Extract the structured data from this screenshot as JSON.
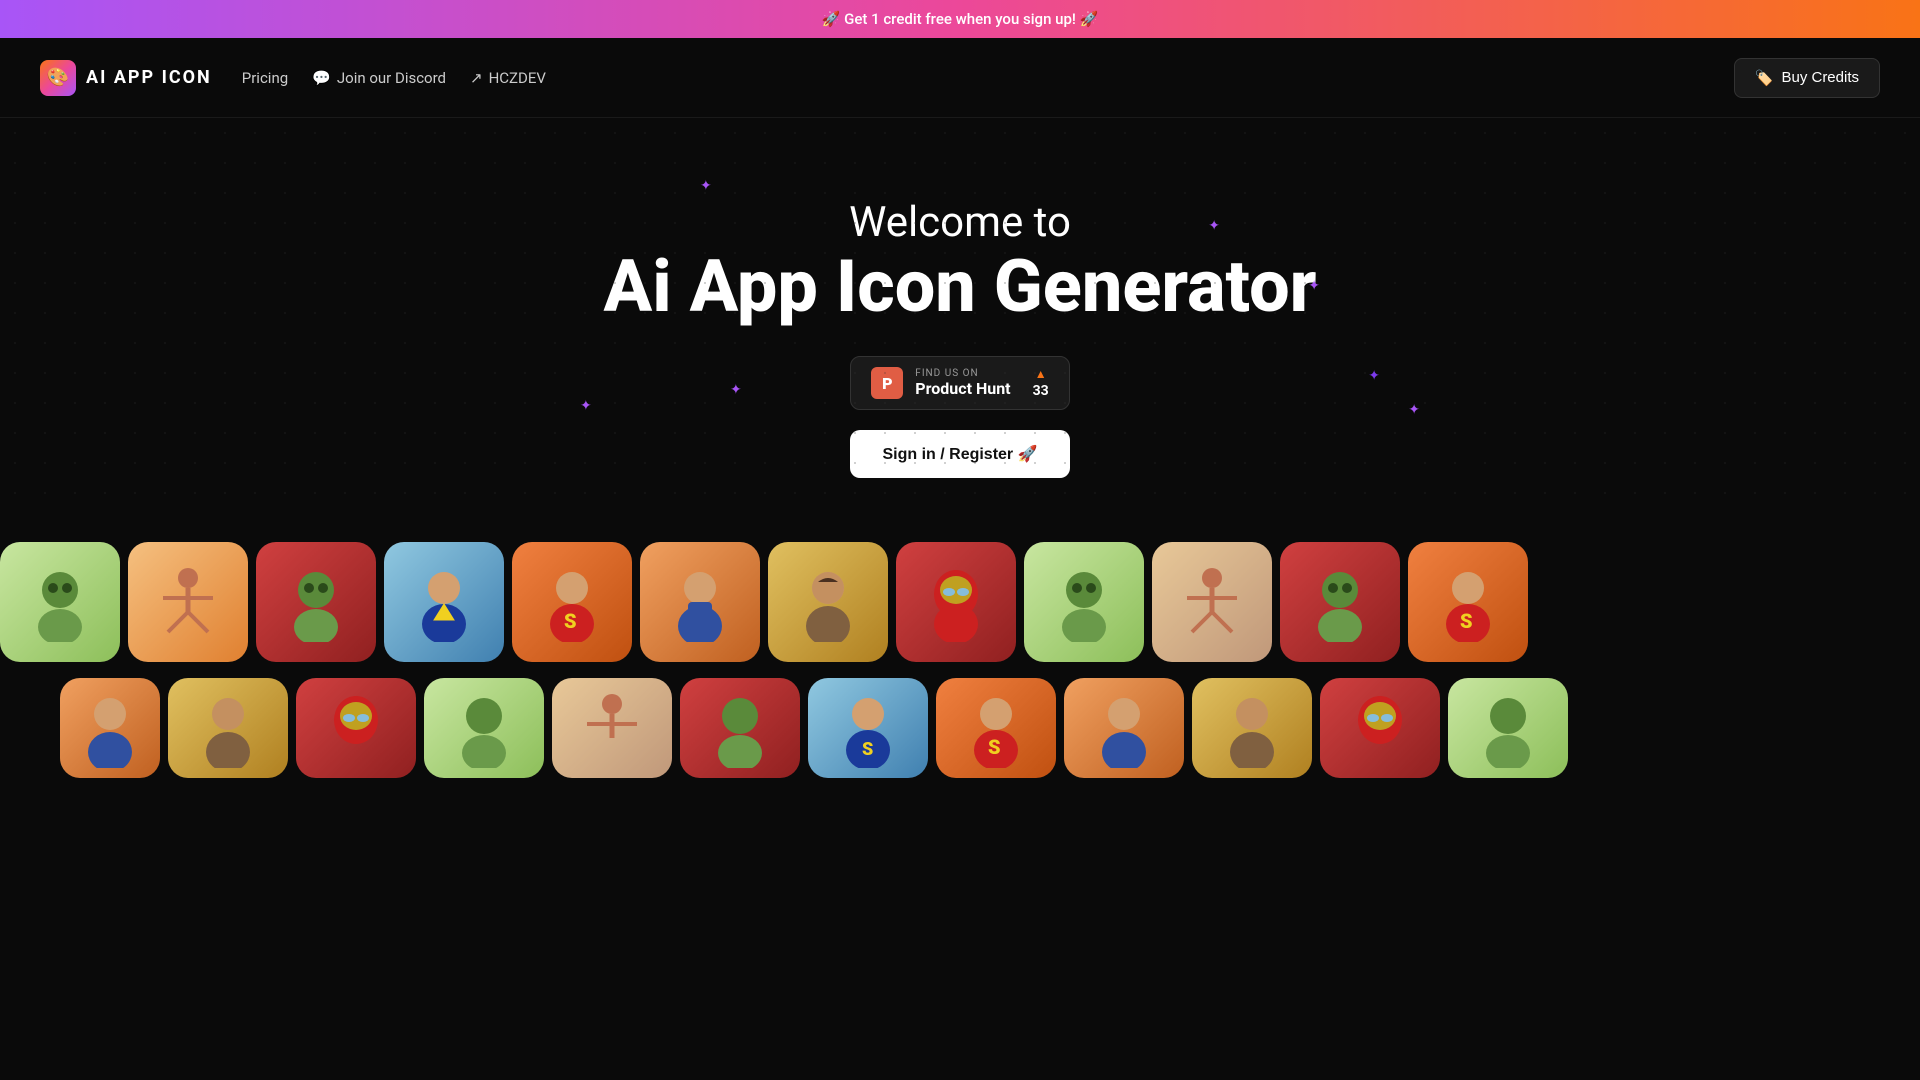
{
  "banner": {
    "text": "🚀 Get 1 credit free when you sign up! 🚀"
  },
  "navbar": {
    "logo_text": "AI APP ICON",
    "links": [
      {
        "label": "Pricing",
        "icon": ""
      },
      {
        "label": "Join our Discord",
        "icon": "💬"
      },
      {
        "label": "HCZDEV",
        "icon": "🔗"
      }
    ],
    "buy_credits_label": "Buy Credits",
    "buy_credits_icon": "🏷️"
  },
  "hero": {
    "subtitle": "Welcome to",
    "title": "Ai App Icon Generator",
    "product_hunt": {
      "find_us": "FIND US ON",
      "name": "Product Hunt",
      "count": "33"
    },
    "signin_label": "Sign in / Register 🚀"
  },
  "icons": {
    "row1": [
      {
        "bg": "green",
        "emoji": "🦹"
      },
      {
        "bg": "orange",
        "emoji": "🧘"
      },
      {
        "bg": "red",
        "emoji": "🦹"
      },
      {
        "bg": "blue",
        "emoji": "🦸"
      },
      {
        "bg": "orange2",
        "emoji": "🦸"
      },
      {
        "bg": "orange3",
        "emoji": "👤"
      },
      {
        "bg": "yellow",
        "emoji": "👤"
      },
      {
        "bg": "red2",
        "emoji": "🦾"
      },
      {
        "bg": "green2",
        "emoji": "🦹"
      },
      {
        "bg": "tan",
        "emoji": "🧘"
      },
      {
        "bg": "red3",
        "emoji": "🦹"
      }
    ],
    "row2": [
      {
        "bg": "orange4",
        "emoji": "👤"
      },
      {
        "bg": "yellow2",
        "emoji": "👤"
      },
      {
        "bg": "red4",
        "emoji": "🦾"
      },
      {
        "bg": "green3",
        "emoji": "🦹"
      },
      {
        "bg": "tan2",
        "emoji": "🧘"
      },
      {
        "bg": "red5",
        "emoji": "🦹"
      },
      {
        "bg": "blue2",
        "emoji": "🦸"
      },
      {
        "bg": "orange5",
        "emoji": "🦸"
      },
      {
        "bg": "orange6",
        "emoji": "👤"
      },
      {
        "bg": "yellow3",
        "emoji": "👤"
      },
      {
        "bg": "red6",
        "emoji": "🦾"
      },
      {
        "bg": "green4",
        "emoji": "🦹"
      }
    ]
  }
}
